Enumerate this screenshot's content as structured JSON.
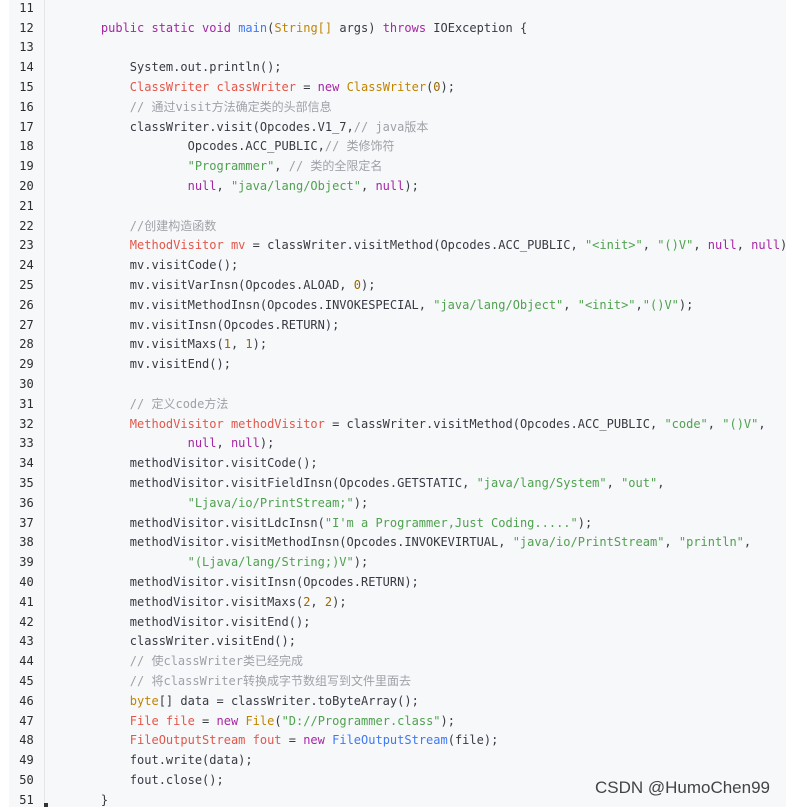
{
  "editor": {
    "lines": [
      {
        "n": "11",
        "html": ""
      },
      {
        "n": "12",
        "html": "    <span class=\"kw\">public static void</span> <span class=\"fn\">main</span>(<span class=\"ty\">String[]</span> args) <span class=\"kw\">throws</span> IOException {"
      },
      {
        "n": "13",
        "html": ""
      },
      {
        "n": "14",
        "html": "        System.out.println();"
      },
      {
        "n": "15",
        "html": "        <span class=\"var\">ClassWriter classWriter</span> = <span class=\"kw\">new</span> <span class=\"ty\">ClassWriter</span>(<span class=\"num\">0</span>);"
      },
      {
        "n": "16",
        "html": "        <span class=\"cm\">// 通过visit方法确定类的头部信息</span>"
      },
      {
        "n": "17",
        "html": "        classWriter.visit(Opcodes.V1_7,<span class=\"cm\">// java版本</span>"
      },
      {
        "n": "18",
        "html": "                Opcodes.ACC_PUBLIC,<span class=\"cm\">// 类修饰符</span>"
      },
      {
        "n": "19",
        "html": "                <span class=\"str\">\"Programmer\"</span>, <span class=\"cm\">// 类的全限定名</span>"
      },
      {
        "n": "20",
        "html": "                <span class=\"kw\">null</span>, <span class=\"str\">\"java/lang/Object\"</span>, <span class=\"kw\">null</span>);"
      },
      {
        "n": "21",
        "html": ""
      },
      {
        "n": "22",
        "html": "        <span class=\"cm\">//创建构造函数</span>"
      },
      {
        "n": "23",
        "html": "        <span class=\"var\">MethodVisitor mv</span> = classWriter.visitMethod(Opcodes.ACC_PUBLIC, <span class=\"str\">\"&lt;init&gt;\"</span>, <span class=\"str\">\"()V\"</span>, <span class=\"kw\">null</span>, <span class=\"kw\">null</span>);"
      },
      {
        "n": "24",
        "html": "        mv.visitCode();"
      },
      {
        "n": "25",
        "html": "        mv.visitVarInsn(Opcodes.ALOAD, <span class=\"num\">0</span>);"
      },
      {
        "n": "26",
        "html": "        mv.visitMethodInsn(Opcodes.INVOKESPECIAL, <span class=\"str\">\"java/lang/Object\"</span>, <span class=\"str\">\"&lt;init&gt;\"</span>,<span class=\"str\">\"()V\"</span>);"
      },
      {
        "n": "27",
        "html": "        mv.visitInsn(Opcodes.RETURN);"
      },
      {
        "n": "28",
        "html": "        mv.visitMaxs(<span class=\"num\">1</span>, <span class=\"num\">1</span>);"
      },
      {
        "n": "29",
        "html": "        mv.visitEnd();"
      },
      {
        "n": "30",
        "html": ""
      },
      {
        "n": "31",
        "html": "        <span class=\"cm\">// 定义code方法</span>"
      },
      {
        "n": "32",
        "html": "        <span class=\"var\">MethodVisitor methodVisitor</span> = classWriter.visitMethod(Opcodes.ACC_PUBLIC, <span class=\"str\">\"code\"</span>, <span class=\"str\">\"()V\"</span>,"
      },
      {
        "n": "33",
        "html": "                <span class=\"kw\">null</span>, <span class=\"kw\">null</span>);"
      },
      {
        "n": "34",
        "html": "        methodVisitor.visitCode();"
      },
      {
        "n": "35",
        "html": "        methodVisitor.visitFieldInsn(Opcodes.GETSTATIC, <span class=\"str\">\"java/lang/System\"</span>, <span class=\"str\">\"out\"</span>,"
      },
      {
        "n": "36",
        "html": "                <span class=\"str\">\"Ljava/io/PrintStream;\"</span>);"
      },
      {
        "n": "37",
        "html": "        methodVisitor.visitLdcInsn(<span class=\"str\">\"I'm a Programmer,Just Coding.....\"</span>);"
      },
      {
        "n": "38",
        "html": "        methodVisitor.visitMethodInsn(Opcodes.INVOKEVIRTUAL, <span class=\"str\">\"java/io/PrintStream\"</span>, <span class=\"str\">\"println\"</span>,"
      },
      {
        "n": "39",
        "html": "                <span class=\"str\">\"(Ljava/lang/String;)V\"</span>);"
      },
      {
        "n": "40",
        "html": "        methodVisitor.visitInsn(Opcodes.RETURN);"
      },
      {
        "n": "41",
        "html": "        methodVisitor.visitMaxs(<span class=\"num\">2</span>, <span class=\"num\">2</span>);"
      },
      {
        "n": "42",
        "html": "        methodVisitor.visitEnd();"
      },
      {
        "n": "43",
        "html": "        classWriter.visitEnd();"
      },
      {
        "n": "44",
        "html": "        <span class=\"cm\">// 使classWriter类已经完成</span>"
      },
      {
        "n": "45",
        "html": "        <span class=\"cm\">// 将classWriter转换成字节数组写到文件里面去</span>"
      },
      {
        "n": "46",
        "html": "        <span class=\"ty\">byte</span>[] data = classWriter.toByteArray();"
      },
      {
        "n": "47",
        "html": "        <span class=\"var\">File file</span> = <span class=\"kw\">new</span> <span class=\"ty\">File</span>(<span class=\"str\">\"D://Programmer.class\"</span>);"
      },
      {
        "n": "48",
        "html": "        <span class=\"var\">FileOutputStream fout</span> = <span class=\"kw\">new</span> <span class=\"fn\">FileOutputStream</span>(file);"
      },
      {
        "n": "49",
        "html": "        fout.write(data);"
      },
      {
        "n": "50",
        "html": "        fout.close();"
      },
      {
        "n": "51",
        "html": "    }"
      }
    ]
  },
  "watermark": "CSDN @HumoChen99"
}
